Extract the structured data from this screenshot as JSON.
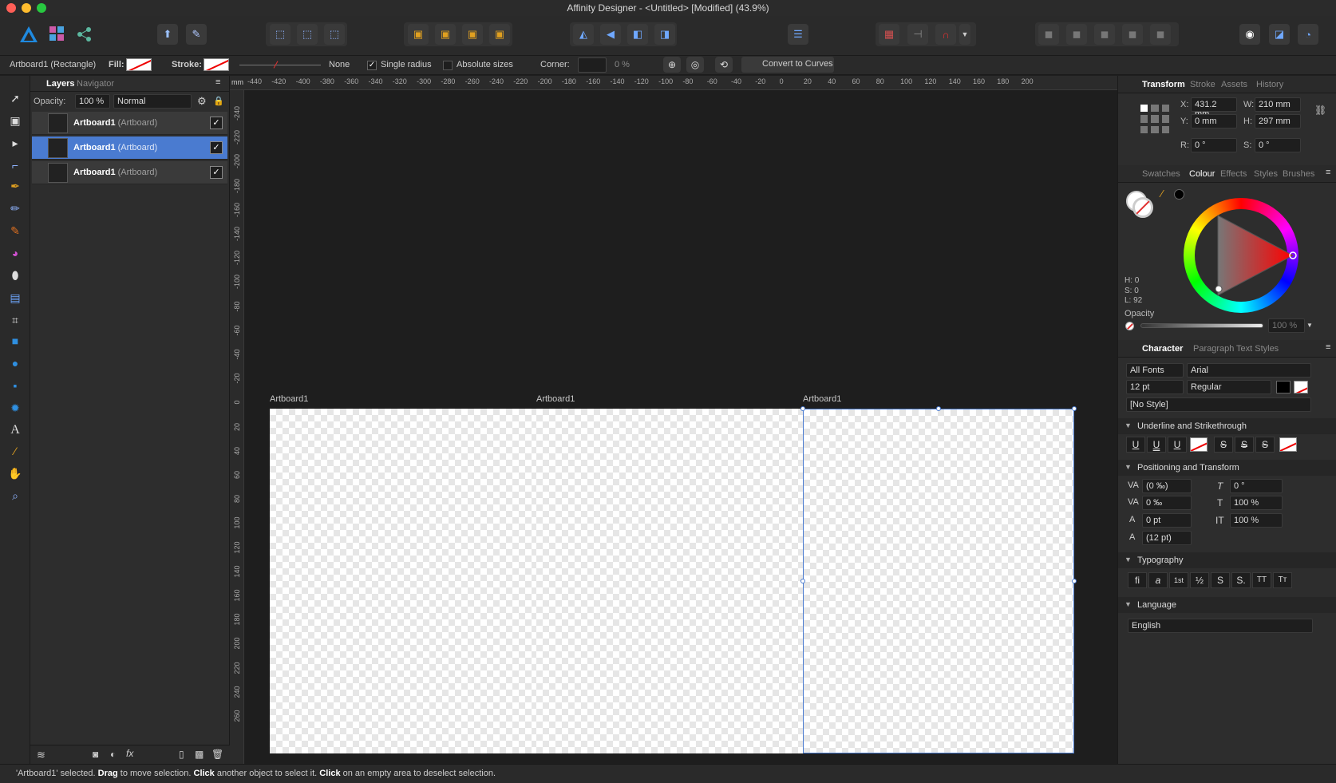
{
  "window": {
    "title": "Affinity Designer - <Untitled> [Modified] (43.9%)"
  },
  "context": {
    "selection": "Artboard1 (Rectangle)",
    "fill_label": "Fill:",
    "stroke_label": "Stroke:",
    "stroke_value": "None",
    "single_radius": "Single radius",
    "absolute_sizes": "Absolute sizes",
    "corner_label": "Corner:",
    "corner_value": "0 %",
    "convert_button": "Convert to Curves"
  },
  "layers_panel": {
    "tabs": [
      "Layers",
      "Navigator"
    ],
    "opacity_label": "Opacity:",
    "opacity_value": "100 %",
    "blend_mode": "Normal",
    "items": [
      {
        "name": "Artboard1",
        "type": "(Artboard)"
      },
      {
        "name": "Artboard1",
        "type": "(Artboard)"
      },
      {
        "name": "Artboard1",
        "type": "(Artboard)"
      }
    ]
  },
  "ruler": {
    "unit": "mm",
    "top_ticks": [
      "-440",
      "-420",
      "-400",
      "-380",
      "-360",
      "-340",
      "-320",
      "-300",
      "-280",
      "-260",
      "-240",
      "-220",
      "-200",
      "-180",
      "-160",
      "-140",
      "-120",
      "-100",
      "-80",
      "-60",
      "-40",
      "-20",
      "0",
      "20",
      "40",
      "60",
      "80",
      "100",
      "120",
      "140",
      "160",
      "180",
      "200"
    ],
    "left_ticks": [
      "-240",
      "-220",
      "-200",
      "-180",
      "-160",
      "-140",
      "-120",
      "-100",
      "-80",
      "-60",
      "-40",
      "-20",
      "0",
      "20",
      "40",
      "60",
      "80",
      "100",
      "120",
      "140",
      "160",
      "180",
      "200",
      "220",
      "240",
      "260"
    ]
  },
  "canvas": {
    "artboards": [
      {
        "label": "Artboard1"
      },
      {
        "label": "Artboard1"
      },
      {
        "label": "Artboard1"
      }
    ]
  },
  "transform_panel": {
    "tabs": [
      "Transform",
      "Stroke",
      "Assets",
      "History"
    ],
    "x_label": "X:",
    "x": "431.2 mm",
    "y_label": "Y:",
    "y": "0 mm",
    "w_label": "W:",
    "w": "210 mm",
    "h_label": "H:",
    "h": "297 mm",
    "r_label": "R:",
    "r": "0 °",
    "s_label": "S:",
    "s": "0 °"
  },
  "colour_panel": {
    "tabs": [
      "Swatches",
      "Colour",
      "Effects",
      "Styles",
      "Brushes"
    ],
    "h": "H: 0",
    "s": "S: 0",
    "l": "L: 92",
    "opacity_label": "Opacity",
    "opacity_value": "100 %"
  },
  "character_panel": {
    "tabs": [
      "Character",
      "Paragraph",
      "Text Styles"
    ],
    "font_collection": "All Fonts",
    "font_family": "Arial",
    "font_size": "12 pt",
    "font_style": "Regular",
    "style": "[No Style]",
    "sections": {
      "underline": "Underline and Strikethrough",
      "positioning": "Positioning and Transform",
      "typography": "Typography",
      "language": "Language"
    },
    "positioning": {
      "kerning": "(0 ‰)",
      "tracking": "0 ‰",
      "baseline": "0 pt",
      "leading": "(12 pt)",
      "shear": "0 °",
      "vscale": "100 %",
      "hscale": "100 %"
    },
    "typography_buttons": [
      "fi",
      "a",
      "1st",
      "½",
      "S",
      "S.",
      "TT",
      "Tт"
    ],
    "language_value": "English"
  },
  "status_bar": {
    "part1": "'Artboard1' selected. ",
    "drag": "Drag",
    "part2": " to move selection. ",
    "click1": "Click",
    "part3": " another object to select it. ",
    "click2": "Click",
    "part4": " on an empty area to deselect selection."
  },
  "colors": {
    "selection": "#4a7bd0",
    "brand": "#2f8fe0"
  }
}
